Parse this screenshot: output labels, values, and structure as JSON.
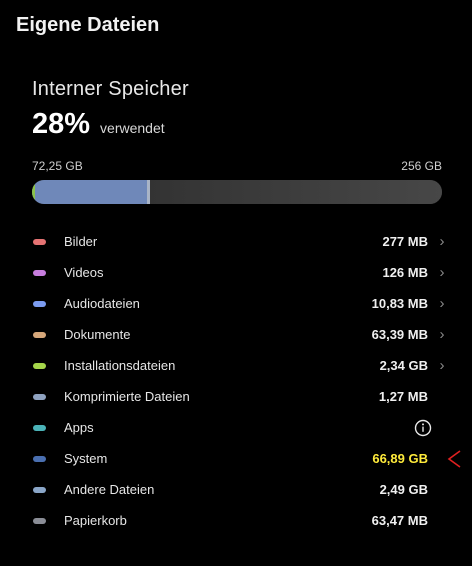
{
  "header": {
    "title": "Eigene Dateien"
  },
  "storage": {
    "title": "Interner Speicher",
    "percent": "28%",
    "used_label": "verwendet",
    "used_amount": "72,25 GB",
    "total_amount": "256 GB",
    "used_fraction": 0.28
  },
  "categories": [
    {
      "label": "Bilder",
      "size": "277 MB",
      "color": "#e57373",
      "chevron": true
    },
    {
      "label": "Videos",
      "size": "126 MB",
      "color": "#c77dde",
      "chevron": true
    },
    {
      "label": "Audiodateien",
      "size": "10,83 MB",
      "color": "#7c9cf0",
      "chevron": true
    },
    {
      "label": "Dokumente",
      "size": "63,39 MB",
      "color": "#d6a77a",
      "chevron": true
    },
    {
      "label": "Installationsdateien",
      "size": "2,34 GB",
      "color": "#a5d64a",
      "chevron": true
    },
    {
      "label": "Komprimierte Dateien",
      "size": "1,27 MB",
      "color": "#8fa2c0",
      "chevron": false
    },
    {
      "label": "Apps",
      "size": "",
      "color": "#4bb3b8",
      "chevron": false,
      "info": true
    },
    {
      "label": "System",
      "size": "66,89 GB",
      "color": "#4a6fb0",
      "chevron": false,
      "highlight": true
    },
    {
      "label": "Andere Dateien",
      "size": "2,49 GB",
      "color": "#8aa6c8",
      "chevron": false
    },
    {
      "label": "Papierkorb",
      "size": "63,47 MB",
      "color": "#8a8d96",
      "chevron": false
    }
  ],
  "colors": {
    "highlight": "#ffeb3b",
    "annotation": "#e02020"
  },
  "icons": {
    "chevron": "chevron-right-icon",
    "info": "info-icon"
  }
}
